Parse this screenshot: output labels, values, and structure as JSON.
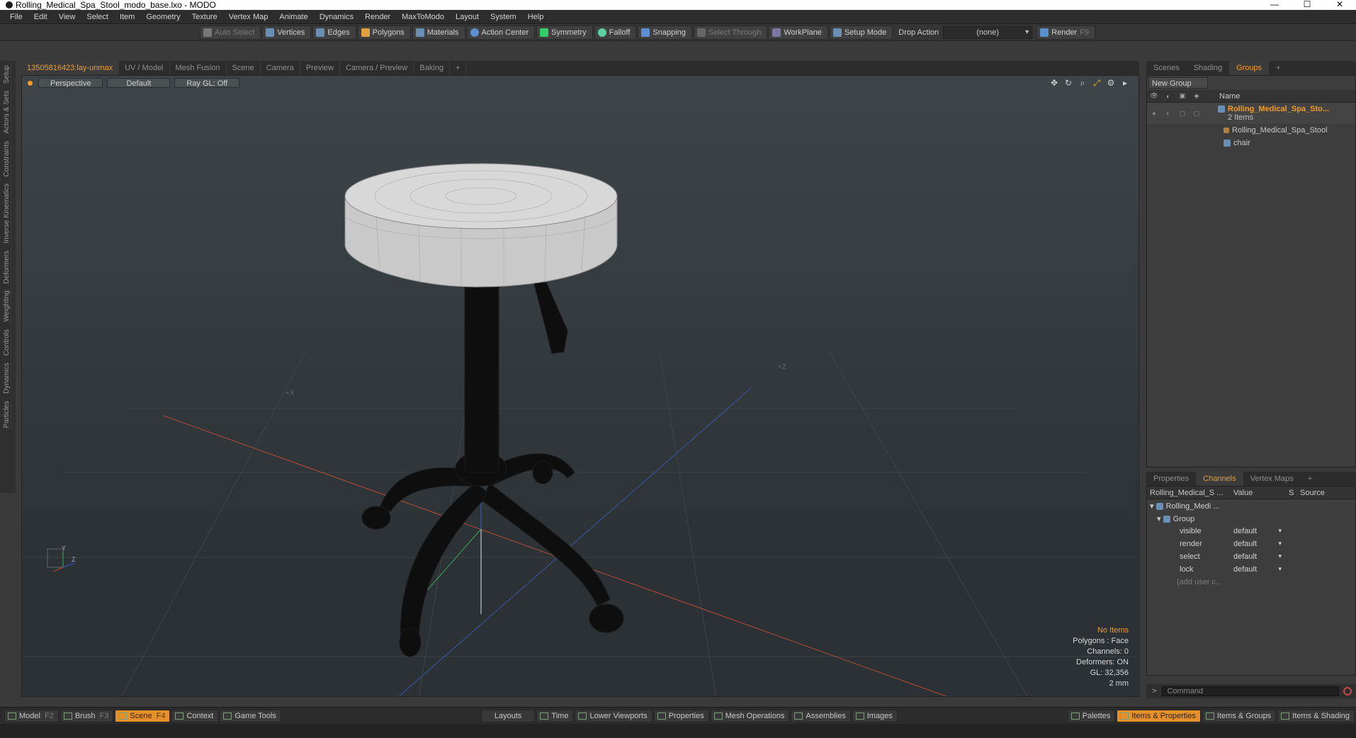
{
  "window": {
    "title": "Rolling_Medical_Spa_Stool_modo_base.lxo - MODO",
    "controls": [
      "—",
      "☐",
      "✕"
    ]
  },
  "menubar": [
    "File",
    "Edit",
    "View",
    "Select",
    "Item",
    "Geometry",
    "Texture",
    "Vertex Map",
    "Animate",
    "Dynamics",
    "Render",
    "MaxToModo",
    "Layout",
    "System",
    "Help"
  ],
  "toolbar": {
    "auto_select": "Auto Select",
    "vertices": "Vertices",
    "edges": "Edges",
    "polygons": "Polygons",
    "materials": "Materials",
    "action_center": "Action Center",
    "symmetry": "Symmetry",
    "falloff": "Falloff",
    "snapping": "Snapping",
    "select_through": "Select Through",
    "workplane": "WorkPlane",
    "setup_mode": "Setup Mode",
    "drop_action": "Drop Action",
    "drop_value": "(none)",
    "render": "Render",
    "render_key": "F9"
  },
  "left_tabs": [
    "Setup",
    "Actors & Sets",
    "Constraints",
    "Inverse Kinematics",
    "Deformers",
    "Weighting",
    "Controls",
    "Dynamics",
    "Particles"
  ],
  "viewport_tabs": [
    "13505816423:lay-unmax",
    "UV / Model",
    "Mesh Fusion",
    "Scene",
    "Camera",
    "Preview",
    "Camera / Preview",
    "Baking",
    "+"
  ],
  "viewport": {
    "view": "Perspective",
    "shading": "Default",
    "raygl": "Ray GL: Off",
    "axis_plus_x": "+X",
    "axis_plus_z": "+Z",
    "info": {
      "items": "No Items",
      "polygons": "Polygons : Face",
      "channels": "Channels: 0",
      "deformers": "Deformers: ON",
      "gl": "GL: 32,356",
      "scale": "2 mm"
    },
    "gizmo": {
      "y": "Y",
      "z": "Z"
    }
  },
  "right_tabs": [
    "Scenes",
    "Shading",
    "Groups",
    "+"
  ],
  "groups": {
    "new_group": "New Group",
    "name_header": "Name",
    "group_name": "Rolling_Medical_Spa_Sto...",
    "group_count": "2 Items",
    "children": [
      "Rolling_Medical_Spa_Stool",
      "chair"
    ]
  },
  "props_tabs": [
    "Properties",
    "Channels",
    "Vertex Maps",
    "+"
  ],
  "channels": {
    "header_name": "Rolling_Medical_S ...",
    "header_value": "Value",
    "header_s": "S",
    "header_source": "Source",
    "root": "Rolling_Medi ...",
    "group": "Group",
    "rows": [
      {
        "name": "visible",
        "value": "default"
      },
      {
        "name": "render",
        "value": "default"
      },
      {
        "name": "select",
        "value": "default"
      },
      {
        "name": "lock",
        "value": "default"
      }
    ],
    "add_user": "(add user c..."
  },
  "command": {
    "prompt": ">",
    "placeholder": "Command"
  },
  "bottombar": {
    "left": [
      {
        "label": "Model",
        "key": "F2"
      },
      {
        "label": "Brush",
        "key": "F3"
      },
      {
        "label": "Scene",
        "key": "F4",
        "active": true
      },
      {
        "label": "Context",
        "key": ""
      },
      {
        "label": "Game Tools",
        "key": ""
      }
    ],
    "center": [
      "Layouts",
      "Time",
      "Lower Viewports",
      "Properties",
      "Mesh Operations",
      "Assemblies",
      "Images"
    ],
    "right": [
      {
        "label": "Palettes",
        "active": false
      },
      {
        "label": "Items & Properties",
        "active": true
      },
      {
        "label": "Items & Groups",
        "active": false
      },
      {
        "label": "Items & Shading",
        "active": false
      }
    ]
  },
  "colors": {
    "accent": "#f39c28",
    "viewport_bg": "#363d41",
    "stool": "#101010",
    "seat": "#cfcfcf"
  }
}
